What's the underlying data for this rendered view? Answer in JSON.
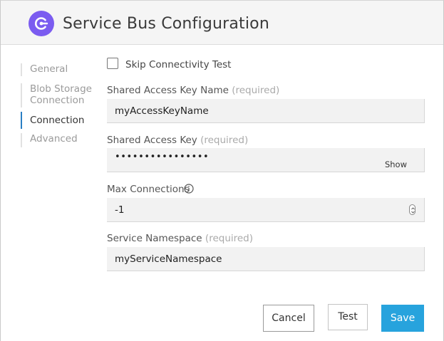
{
  "header": {
    "title": "Service Bus Configuration",
    "logo_icon": "service-bus-logo-icon",
    "logo_color": "#7b5cf0"
  },
  "sidebar": {
    "items": [
      {
        "label": "General",
        "active": false
      },
      {
        "label": "Blob Storage Connection",
        "active": false
      },
      {
        "label": "Connection",
        "active": true
      },
      {
        "label": "Advanced",
        "active": false
      }
    ]
  },
  "form": {
    "skip_test": {
      "label": "Skip Connectivity Test",
      "checked": false
    },
    "key_name": {
      "label": "Shared Access Key Name",
      "required": "(required)",
      "value": "myAccessKeyName"
    },
    "access_key": {
      "label": "Shared Access Key",
      "required": "(required)",
      "value": "••••••••••••••••",
      "show_label": "Show"
    },
    "max_connections": {
      "label": "Max Connections",
      "value": "-1",
      "info_icon": "info-icon"
    },
    "namespace": {
      "label": "Service Namespace",
      "required": "(required)",
      "value": "myServiceNamespace"
    }
  },
  "buttons": {
    "cancel": "Cancel",
    "test": "Test",
    "save": "Save"
  },
  "colors": {
    "accent": "#27a3dd",
    "active_nav_border": "#2a7fc4"
  }
}
